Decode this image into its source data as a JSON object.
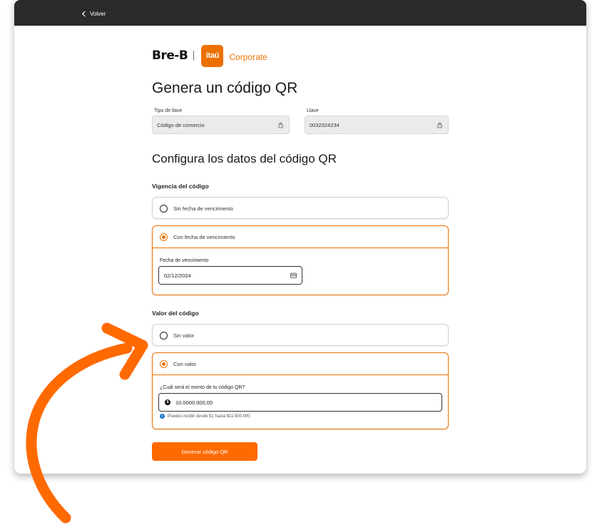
{
  "topbar": {
    "back_label": "Volver"
  },
  "brand": {
    "breb": "Bre-B",
    "itau": "itaú",
    "corporate": "Corporate"
  },
  "page_title": "Genera un código QR",
  "key_type": {
    "label": "Tipo de llave",
    "value": "Código de comercio"
  },
  "key": {
    "label": "Llave",
    "value": "0032324234"
  },
  "section_title": "Configura los datos del código QR",
  "validity": {
    "title": "Vigencia del código",
    "option_no_date": "Sin fecha de vencimiento",
    "option_with_date": "Con fecha de vencimiento",
    "date_label": "Fecha de vencimiento",
    "date_value": "02/12/2024"
  },
  "amount": {
    "title": "Valor del código",
    "option_no_value": "Sin valor",
    "option_with_value": "Con valor",
    "amount_label": "¿Cuál será el monto de tu código QR?",
    "amount_value": "10.0000.000,00",
    "help": "Puedes recibir desde $1 hasta $11.500.000"
  },
  "submit_label": "Generar código QR",
  "colors": {
    "accent": "#ec7000",
    "button": "#ff6a00",
    "topbar": "#2a2a2a",
    "info": "#1a73c8"
  }
}
